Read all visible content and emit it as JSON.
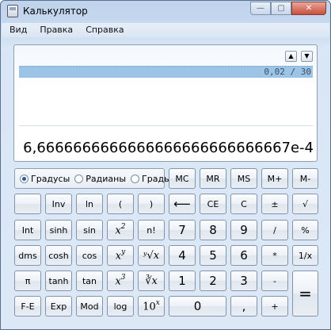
{
  "window": {
    "title": "Калькулятор",
    "minimize": "—",
    "maximize": "▢",
    "close": "✕"
  },
  "menu": [
    "Вид",
    "Правка",
    "Справка"
  ],
  "display": {
    "history_up": "▲",
    "history_down": "▼",
    "history_expression": "0,02 / 30",
    "result": "6,6666666666666666666666666667e-4"
  },
  "angle_units": {
    "options": [
      "Градусы",
      "Радианы",
      "Грады"
    ],
    "selected": "Градусы"
  },
  "keys": {
    "mc": "MC",
    "mr": "MR",
    "ms": "MS",
    "mplus": "M+",
    "mminus": "M-",
    "inv": "Inv",
    "ln": "ln",
    "lparen": "(",
    "rparen": ")",
    "backspace": "⟵",
    "ce": "CE",
    "c": "C",
    "plusminus": "±",
    "sqrt": "√",
    "int": "Int",
    "sinh": "sinh",
    "sin": "sin",
    "x2": "x",
    "x2_exp": "2",
    "nfact": "n!",
    "d7": "7",
    "d8": "8",
    "d9": "9",
    "divide": "/",
    "percent": "%",
    "dms": "dms",
    "cosh": "cosh",
    "cos": "cos",
    "xy": "x",
    "xy_exp": "y",
    "yroot": "ʸ√x",
    "d4": "4",
    "d5": "5",
    "d6": "6",
    "multiply": "*",
    "reciprocal": "1/x",
    "pi": "π",
    "tanh": "tanh",
    "tan": "tan",
    "x3": "x",
    "x3_exp": "3",
    "cuberoot": "∛x",
    "d1": "1",
    "d2": "2",
    "d3": "3",
    "minus": "-",
    "equals": "=",
    "fe": "F-E",
    "exp": "Exp",
    "mod": "Mod",
    "log": "log",
    "ten_x": "10",
    "ten_x_exp": "x",
    "d0": "0",
    "decimal": ",",
    "plus": "+"
  }
}
